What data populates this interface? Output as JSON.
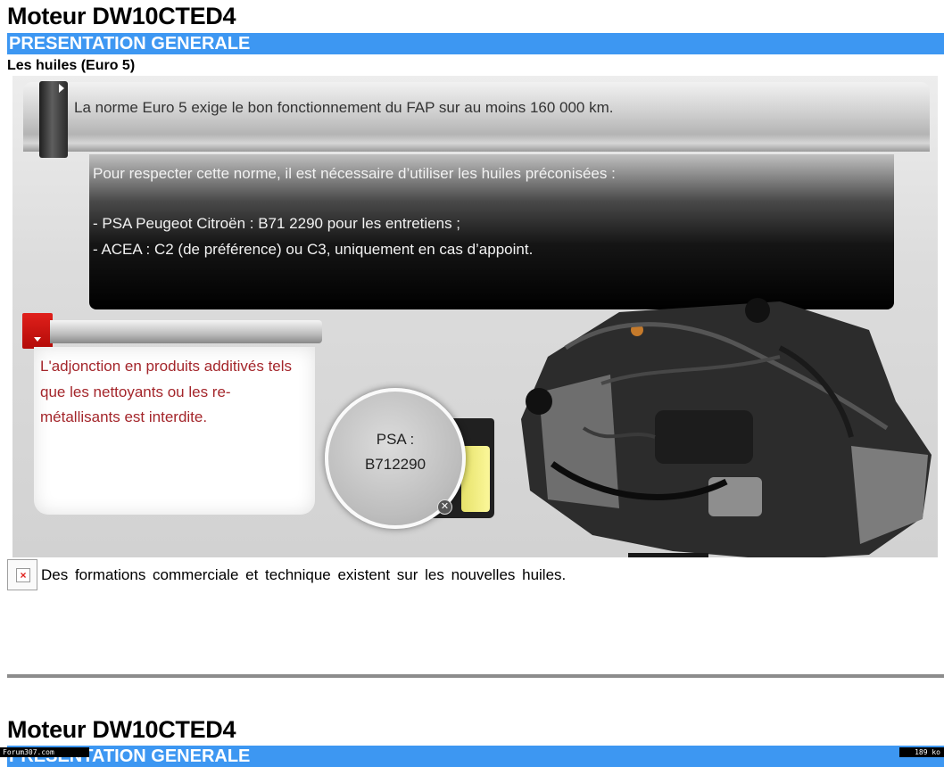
{
  "page": {
    "title": "Moteur DW10CTED4",
    "section": "PRESENTATION GENERALE",
    "subtitle": "Les huiles (Euro 5)"
  },
  "banner": {
    "text": "La norme Euro 5 exige le bon fonctionnement du FAP sur au moins 160 000 km."
  },
  "black_box": {
    "line1": "Pour respecter cette norme, il est nécessaire d’utiliser les huiles préconisées :",
    "line2": "- PSA Peugeot Citroën : B71 2290 pour les entretiens ;",
    "line3": "- ACEA : C2 (de préférence) ou C3, uniquement en cas d’appoint."
  },
  "note": {
    "text": "L'adjonction en produits additivés tels que les nettoyants ou les re-métallisants est interdite."
  },
  "callout": {
    "line1": "PSA :",
    "line2": "B712290"
  },
  "footer": {
    "text": "Des formations commerciale et technique existent sur les nouvelles huiles."
  },
  "next_page": {
    "title": "Moteur DW10CTED4",
    "section": "PRESENTATION GENERALE"
  },
  "watermark": {
    "left": "Forum307.com",
    "right": "189 ko"
  },
  "colors": {
    "section_bar": "#3d97f2",
    "note_text": "#a4262b",
    "red_tab": "#e0201b"
  },
  "icons": {
    "banner_tab": "chevron-right-icon",
    "red_tab": "chevron-down-icon",
    "footer_icon": "broken-image-icon",
    "callout_close": "close-icon"
  }
}
